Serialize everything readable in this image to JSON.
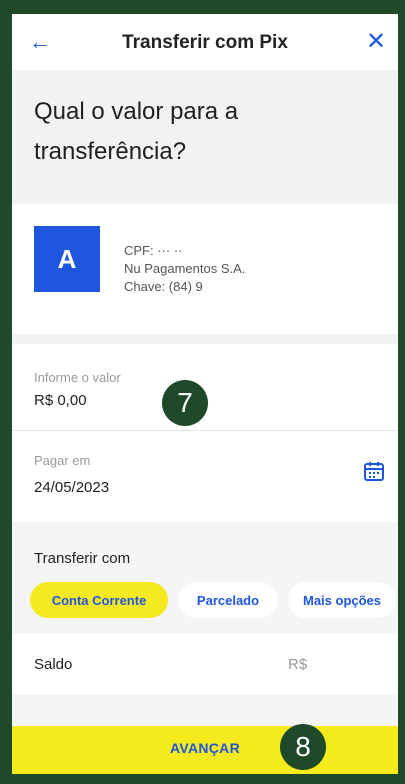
{
  "header": {
    "title": "Transferir com Pix",
    "back_icon": "arrow-left-icon",
    "close_icon": "close-icon"
  },
  "heading": "Qual o valor para a transferência?",
  "recipient": {
    "avatar_letter": "A",
    "cpf_line": "CPF: ···            ··",
    "bank": "Nu Pagamentos S.A.",
    "key_line": "Chave: (84) 9"
  },
  "amount": {
    "label": "Informe o valor",
    "value": "R$ 0,00"
  },
  "date": {
    "label": "Pagar em",
    "value": "24/05/2023",
    "icon": "calendar-icon"
  },
  "transfer": {
    "title": "Transferir com",
    "options": [
      "Conta Corrente",
      "Parcelado",
      "Mais opções"
    ],
    "selected": "Conta Corrente"
  },
  "balance": {
    "label": "Saldo",
    "value": "R$"
  },
  "footer": {
    "button_label": "AVANÇAR"
  },
  "annotations": {
    "step7": "7",
    "step8": "8"
  },
  "colors": {
    "accent_blue": "#1e56e0",
    "brand_yellow": "#f4ea1c",
    "marker_green": "#1f4a2a"
  }
}
